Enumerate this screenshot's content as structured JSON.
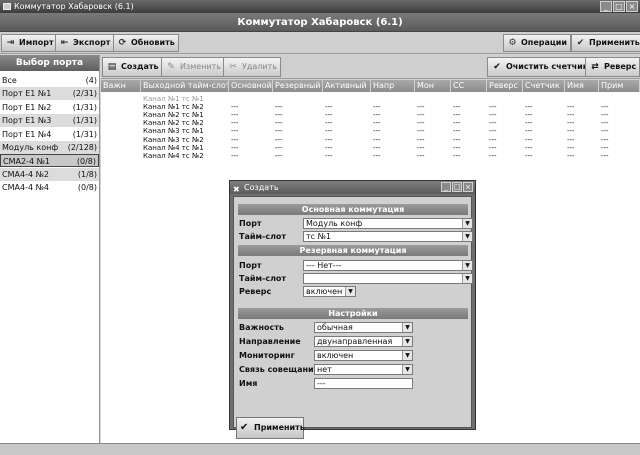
{
  "window": {
    "title": "Коммутатор Хабаровск (6.1)",
    "header": "Коммутатор Хабаровск (6.1)"
  },
  "toolbar": {
    "import_label": "Импорт",
    "export_label": "Экспорт",
    "refresh_label": "Обновить",
    "operations_label": "Операции",
    "apply_label": "Применить"
  },
  "left_panel": {
    "title": "Выбор порта",
    "ports": [
      {
        "name": "Все",
        "count": "(4)"
      },
      {
        "name": "Порт E1 №1",
        "count": "(2/31)"
      },
      {
        "name": "Порт E1 №2",
        "count": "(1/31)"
      },
      {
        "name": "Порт E1 №3",
        "count": "(1/31)"
      },
      {
        "name": "Порт E1 №4",
        "count": "(1/31)"
      },
      {
        "name": "Модуль конф",
        "count": "(2/128)"
      },
      {
        "name": "СМА2-4 №1",
        "count": "(0/8)"
      },
      {
        "name": "СМА4-4 №2",
        "count": "(1/8)"
      },
      {
        "name": "СМА4-4 №4",
        "count": "(0/8)"
      }
    ]
  },
  "right_toolbar": {
    "create_label": "Создать",
    "edit_label": "Изменить",
    "delete_label": "Удалить",
    "clear_counter_label": "Очистить счетчик",
    "reverse_label": "Реверс"
  },
  "table": {
    "columns": [
      "Важн",
      "Выходной тайм-слот",
      "Основной",
      "Резервный",
      "Активный",
      "Напр",
      "Мон",
      "СС",
      "Реверс",
      "Счетчик",
      "Имя",
      "Прим"
    ],
    "rows": [
      [
        "",
        "Канал №1 тс №1",
        "",
        "",
        "",
        "",
        "",
        "",
        "",
        "",
        "",
        ""
      ],
      [
        "",
        "Канал №1 тс №2",
        "---",
        "---",
        "---",
        "---",
        "---",
        "---",
        "---",
        "---",
        "---",
        "---"
      ],
      [
        "",
        "Канал №2 тс №1",
        "---",
        "---",
        "---",
        "---",
        "---",
        "---",
        "---",
        "---",
        "---",
        "---"
      ],
      [
        "",
        "Канал №2 тс №2",
        "---",
        "---",
        "---",
        "---",
        "---",
        "---",
        "---",
        "---",
        "---",
        "---"
      ],
      [
        "",
        "Канал №3 тс №1",
        "---",
        "---",
        "---",
        "---",
        "---",
        "---",
        "---",
        "---",
        "---",
        "---"
      ],
      [
        "",
        "Канал №3 тс №2",
        "---",
        "---",
        "---",
        "---",
        "---",
        "---",
        "---",
        "---",
        "---",
        "---"
      ],
      [
        "",
        "Канал №4 тс №1",
        "---",
        "---",
        "---",
        "---",
        "---",
        "---",
        "---",
        "---",
        "---",
        "---"
      ],
      [
        "",
        "Канал №4 тс №2",
        "---",
        "---",
        "---",
        "---",
        "---",
        "---",
        "---",
        "---",
        "---",
        "---"
      ]
    ]
  },
  "dialog": {
    "title": "Создать",
    "main_section": "Основная коммутация",
    "reserve_section": "Резервная коммутация",
    "settings_section": "Настройки",
    "port_label": "Порт",
    "timeslot_label": "Тайм-слот",
    "reverse_label": "Реверс",
    "importance_label": "Важность",
    "direction_label": "Направление",
    "monitoring_label": "Мониторинг",
    "meeting_label": "Связь совещания",
    "name_label": "Имя",
    "main_port": "Модуль конф",
    "main_timeslot": "тс №1",
    "reserve_port": "--- Нет---",
    "reserve_timeslot": "",
    "reverse_value": "включен",
    "importance_value": "обычная",
    "direction_value": "двунаправленная",
    "monitoring_value": "включен",
    "meeting_value": "нет",
    "name_value": "---",
    "apply_label": "Применить"
  }
}
